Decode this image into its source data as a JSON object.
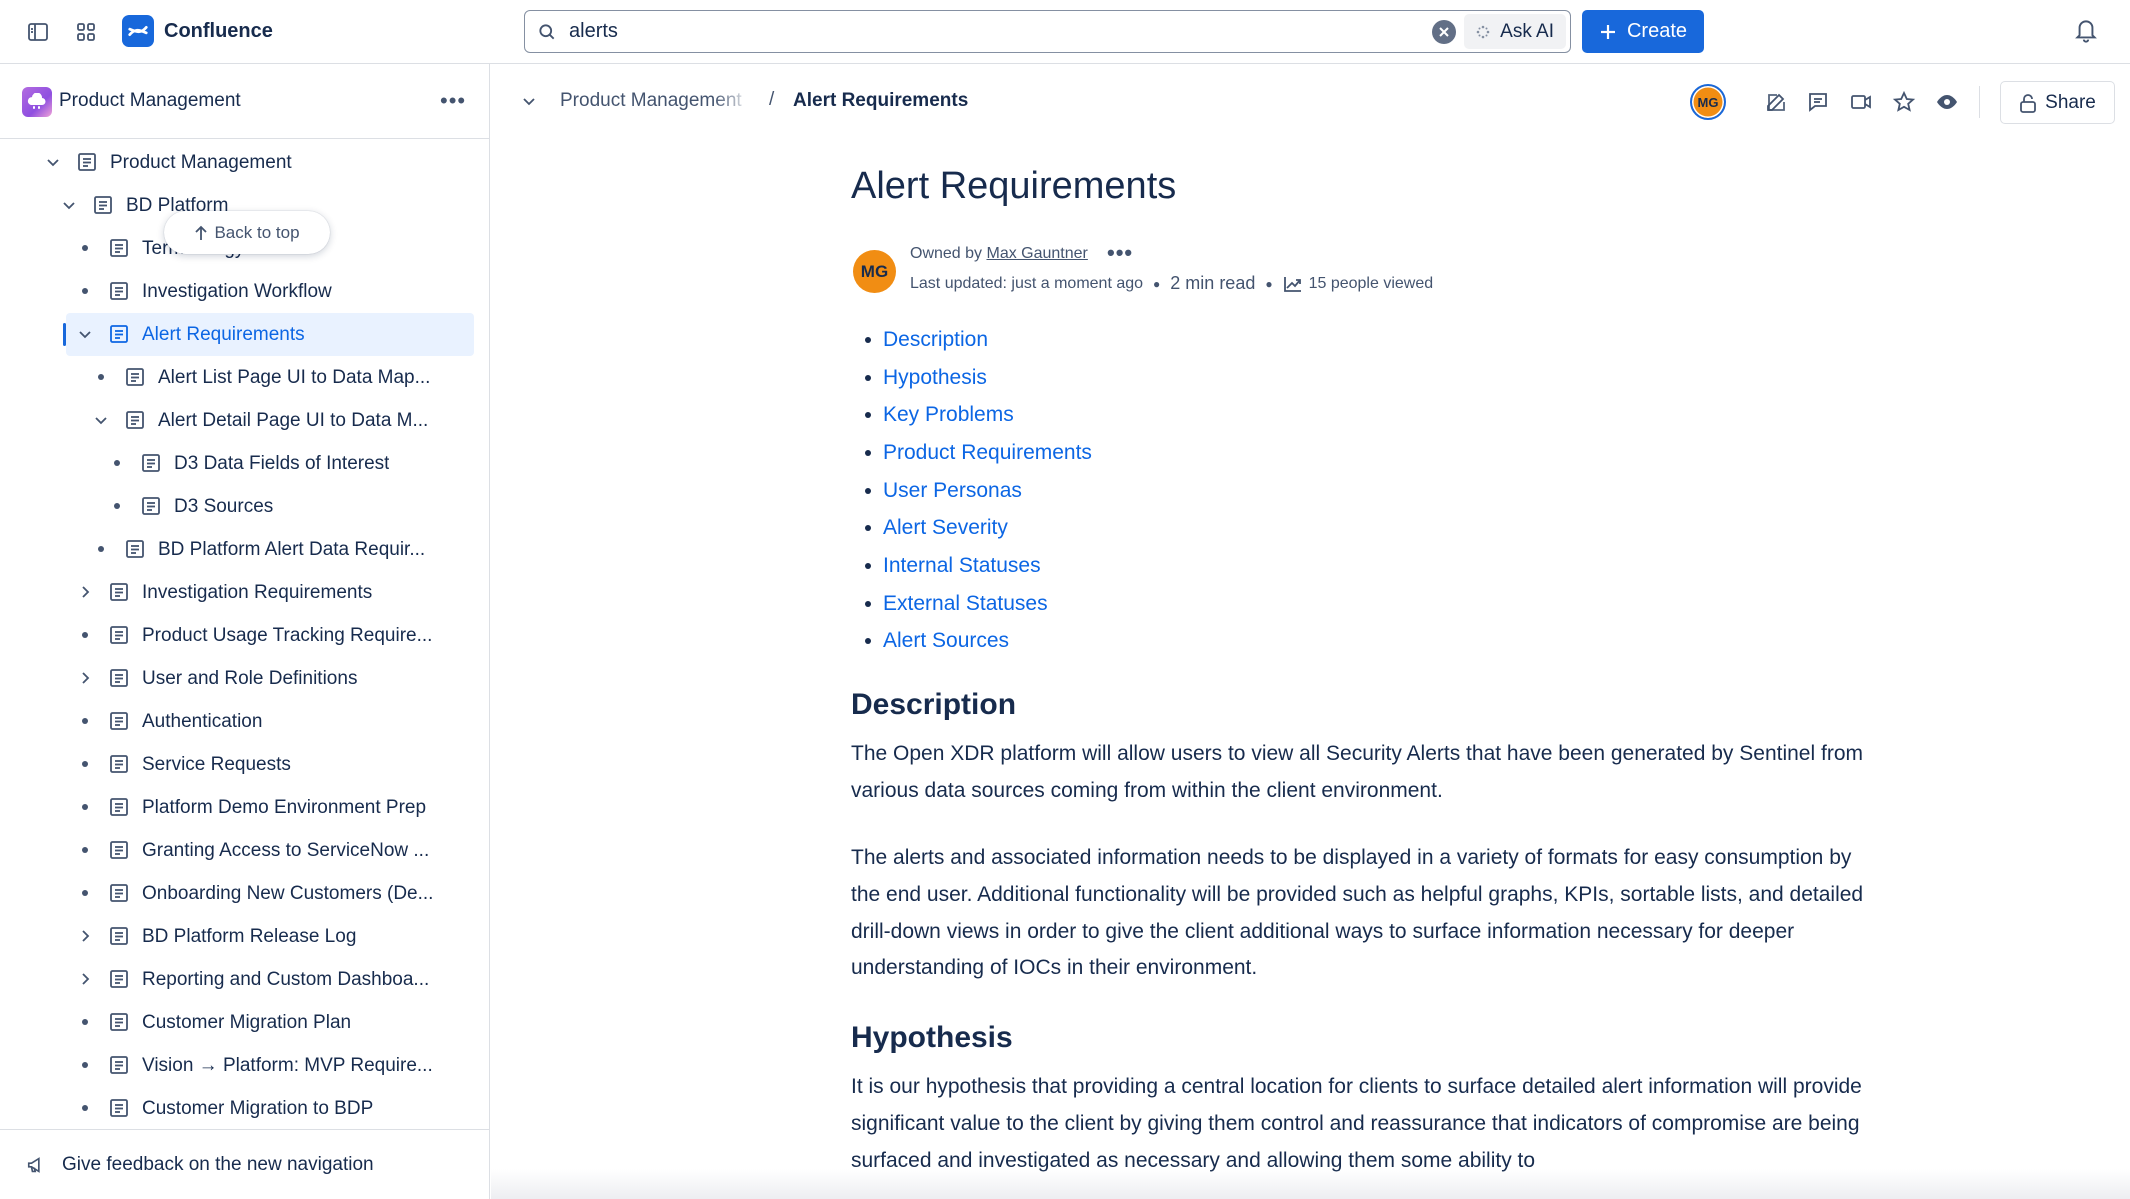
{
  "app": {
    "name": "Confluence",
    "search": {
      "value": "alerts",
      "ask_ai_label": "Ask AI"
    },
    "create_label": "Create"
  },
  "sidebar": {
    "space_name": "Product Management",
    "more_label": "•••",
    "back_to_top_label": "Back to top",
    "items": [
      {
        "label": "Product Management",
        "level": 0,
        "toggle": "expanded"
      },
      {
        "label": "BD Platform",
        "level": 1,
        "toggle": "expanded"
      },
      {
        "label": "Terminology",
        "level": 2,
        "toggle": "bullet"
      },
      {
        "label": "Investigation Workflow",
        "level": 2,
        "toggle": "bullet"
      },
      {
        "label": "Alert Requirements",
        "level": 2,
        "toggle": "expanded",
        "selected": true
      },
      {
        "label": "Alert List Page UI to Data Map...",
        "level": 3,
        "toggle": "bullet"
      },
      {
        "label": "Alert Detail Page UI to Data M...",
        "level": 3,
        "toggle": "expanded"
      },
      {
        "label": "D3 Data Fields of Interest",
        "level": 4,
        "toggle": "bullet"
      },
      {
        "label": "D3 Sources",
        "level": 4,
        "toggle": "bullet"
      },
      {
        "label": "BD Platform Alert Data Requir...",
        "level": 3,
        "toggle": "bullet"
      },
      {
        "label": "Investigation Requirements",
        "level": 2,
        "toggle": "collapsed"
      },
      {
        "label": "Product Usage Tracking Require...",
        "level": 2,
        "toggle": "bullet"
      },
      {
        "label": "User and Role Definitions",
        "level": 2,
        "toggle": "collapsed"
      },
      {
        "label": "Authentication",
        "level": 2,
        "toggle": "bullet"
      },
      {
        "label": "Service Requests",
        "level": 2,
        "toggle": "bullet"
      },
      {
        "label": "Platform Demo Environment Prep",
        "level": 2,
        "toggle": "bullet"
      },
      {
        "label": "Granting Access to ServiceNow ...",
        "level": 2,
        "toggle": "bullet"
      },
      {
        "label": "Onboarding New Customers (De...",
        "level": 2,
        "toggle": "bullet"
      },
      {
        "label": "BD Platform Release Log",
        "level": 2,
        "toggle": "collapsed"
      },
      {
        "label": "Reporting and Custom Dashboa...",
        "level": 2,
        "toggle": "collapsed"
      },
      {
        "label": "Customer Migration Plan",
        "level": 2,
        "toggle": "bullet"
      },
      {
        "label": "Vision → Platform: MVP Require...",
        "level": 2,
        "toggle": "bullet"
      },
      {
        "label": "Customer Migration to BDP",
        "level": 2,
        "toggle": "bullet"
      }
    ],
    "feedback_label": "Give feedback on the new navigation"
  },
  "page_header": {
    "breadcrumb_parent": "Product Management",
    "breadcrumb_separator": "/",
    "breadcrumb_current": "Alert Requirements",
    "viewer_initials": "MG",
    "share_label": "Share"
  },
  "page": {
    "title": "Alert Requirements",
    "owner_initials": "MG",
    "owned_by_prefix": "Owned by ",
    "owner_name": "Max Gauntner",
    "owner_menu": "•••",
    "last_updated": "Last updated: just a moment ago",
    "read_time": "2 min read",
    "views": "15 people viewed",
    "toc": [
      "Description",
      "Hypothesis",
      "Key Problems",
      "Product Requirements",
      "User Personas",
      "Alert Severity",
      "Internal Statuses",
      "External Statuses",
      "Alert Sources"
    ],
    "sections": {
      "description_heading": "Description",
      "description_p1": "The Open XDR platform will allow users to view all Security Alerts that have been generated by Sentinel from various data sources coming from within the client environment.",
      "description_p2": "The alerts and associated information needs to be displayed in a variety of formats for easy consumption by the end user. Additional functionality will be provided such as helpful graphs, KPIs, sortable lists, and detailed drill-down views in order to give the client additional ways to surface information necessary for deeper understanding of IOCs in their environment.",
      "hypothesis_heading": "Hypothesis",
      "hypothesis_p1": "It is our hypothesis that providing a central location for clients to surface detailed alert information will provide significant value to the client by giving them control and reassurance that indicators of compromise are being surfaced and investigated as necessary and allowing them some ability to"
    }
  },
  "colors": {
    "brand": "#1868db",
    "link": "#0c66e4",
    "text": "#172b4d",
    "subtle": "#44546f",
    "selected_bg": "#e9f2ff",
    "avatar": "#f18d13"
  },
  "icons": [
    "sidebar-toggle-icon",
    "app-switcher-icon",
    "confluence-logo-icon",
    "search-icon",
    "clear-icon",
    "ai-sparkle-icon",
    "plus-icon",
    "bell-icon",
    "page-icon",
    "chevron-down-icon",
    "chevron-right-icon",
    "megaphone-icon",
    "edit-icon",
    "comment-icon",
    "video-icon",
    "star-icon",
    "eye-icon",
    "lock-icon",
    "trend-icon",
    "arrow-up-icon"
  ]
}
